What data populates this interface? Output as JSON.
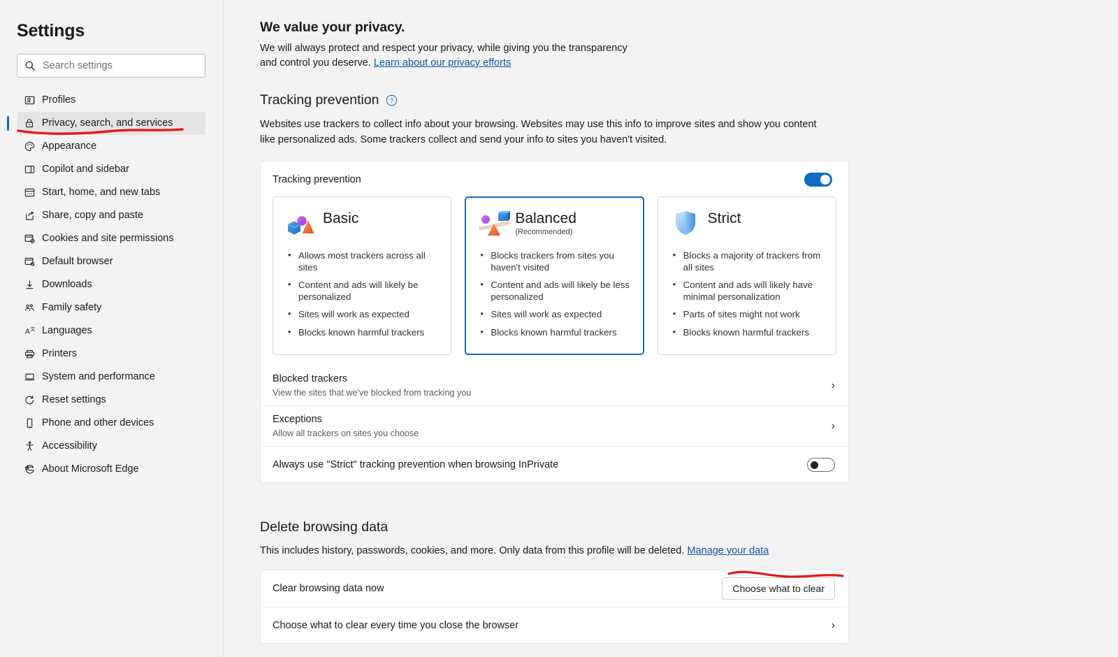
{
  "sidebar": {
    "title": "Settings",
    "search": {
      "placeholder": "Search settings",
      "value": "",
      "icon": "search-icon"
    },
    "items": [
      {
        "label": "Profiles",
        "icon": "profile-card-icon",
        "selected": false
      },
      {
        "label": "Privacy, search, and services",
        "icon": "lock-icon",
        "selected": true
      },
      {
        "label": "Appearance",
        "icon": "palette-icon",
        "selected": false
      },
      {
        "label": "Copilot and sidebar",
        "icon": "sidebar-panel-icon",
        "selected": false
      },
      {
        "label": "Start, home, and new tabs",
        "icon": "browser-window-icon",
        "selected": false
      },
      {
        "label": "Share, copy and paste",
        "icon": "share-icon",
        "selected": false
      },
      {
        "label": "Cookies and site permissions",
        "icon": "cookie-settings-icon",
        "selected": false
      },
      {
        "label": "Default browser",
        "icon": "default-browser-check-icon",
        "selected": false
      },
      {
        "label": "Downloads",
        "icon": "download-arrow-icon",
        "selected": false
      },
      {
        "label": "Family safety",
        "icon": "family-people-icon",
        "selected": false
      },
      {
        "label": "Languages",
        "icon": "languages-icon",
        "selected": false
      },
      {
        "label": "Printers",
        "icon": "printer-icon",
        "selected": false
      },
      {
        "label": "System and performance",
        "icon": "laptop-icon",
        "selected": false
      },
      {
        "label": "Reset settings",
        "icon": "reset-arrow-icon",
        "selected": false
      },
      {
        "label": "Phone and other devices",
        "icon": "phone-icon",
        "selected": false
      },
      {
        "label": "Accessibility",
        "icon": "accessibility-person-icon",
        "selected": false
      },
      {
        "label": "About Microsoft Edge",
        "icon": "edge-logo-icon",
        "selected": false
      }
    ]
  },
  "main": {
    "privacy_heading": "We value your privacy.",
    "privacy_text_1": "We will always protect and respect your privacy, while giving you the transparency",
    "privacy_text_2": "and control you deserve.",
    "privacy_link": "Learn about our privacy efforts",
    "tracking": {
      "heading": "Tracking prevention",
      "help_icon": "help-circle-icon",
      "description": "Websites use trackers to collect info about your browsing. Websites may use this info to improve sites and show you content like personalized ads. Some trackers collect and send your info to sites you haven't visited.",
      "panel_label": "Tracking prevention",
      "toggle_state": "on",
      "cards": [
        {
          "title": "Basic",
          "subtitle": "",
          "icon": "shapes-cube-sphere-cone-icon",
          "selected": false,
          "bullets": [
            "Allows most trackers across all sites",
            "Content and ads will likely be personalized",
            "Sites will work as expected",
            "Blocks known harmful trackers"
          ]
        },
        {
          "title": "Balanced",
          "subtitle": "(Recommended)",
          "icon": "seesaw-balance-icon",
          "selected": true,
          "bullets": [
            "Blocks trackers from sites you haven't visited",
            "Content and ads will likely be less personalized",
            "Sites will work as expected",
            "Blocks known harmful trackers"
          ]
        },
        {
          "title": "Strict",
          "subtitle": "",
          "icon": "shield-icon",
          "selected": false,
          "bullets": [
            "Blocks a majority of trackers from all sites",
            "Content and ads will likely have minimal personalization",
            "Parts of sites might not work",
            "Blocks known harmful trackers"
          ]
        }
      ],
      "rows": [
        {
          "title": "Blocked trackers",
          "sub": "View the sites that we've blocked from tracking you",
          "control": "chevron",
          "chevron": "›"
        },
        {
          "title": "Exceptions",
          "sub": "Allow all trackers on sites you choose",
          "control": "chevron",
          "chevron": "›"
        },
        {
          "title": "Always use \"Strict\" tracking prevention when browsing InPrivate",
          "sub": "",
          "control": "toggle",
          "toggle_state": "off"
        }
      ]
    },
    "delete_data": {
      "heading": "Delete browsing data",
      "description": "This includes history, passwords, cookies, and more. Only data from this profile will be deleted.",
      "link": "Manage your data",
      "rows": [
        {
          "title": "Clear browsing data now",
          "control": "button",
          "button_label": "Choose what to clear"
        },
        {
          "title": "Choose what to clear every time you close the browser",
          "control": "chevron",
          "chevron": "›"
        }
      ]
    }
  },
  "annotations": {
    "color": "#e01b1b",
    "marks": [
      "underline-privacy-sidebar-item",
      "underline-choose-what-to-clear-button"
    ]
  }
}
